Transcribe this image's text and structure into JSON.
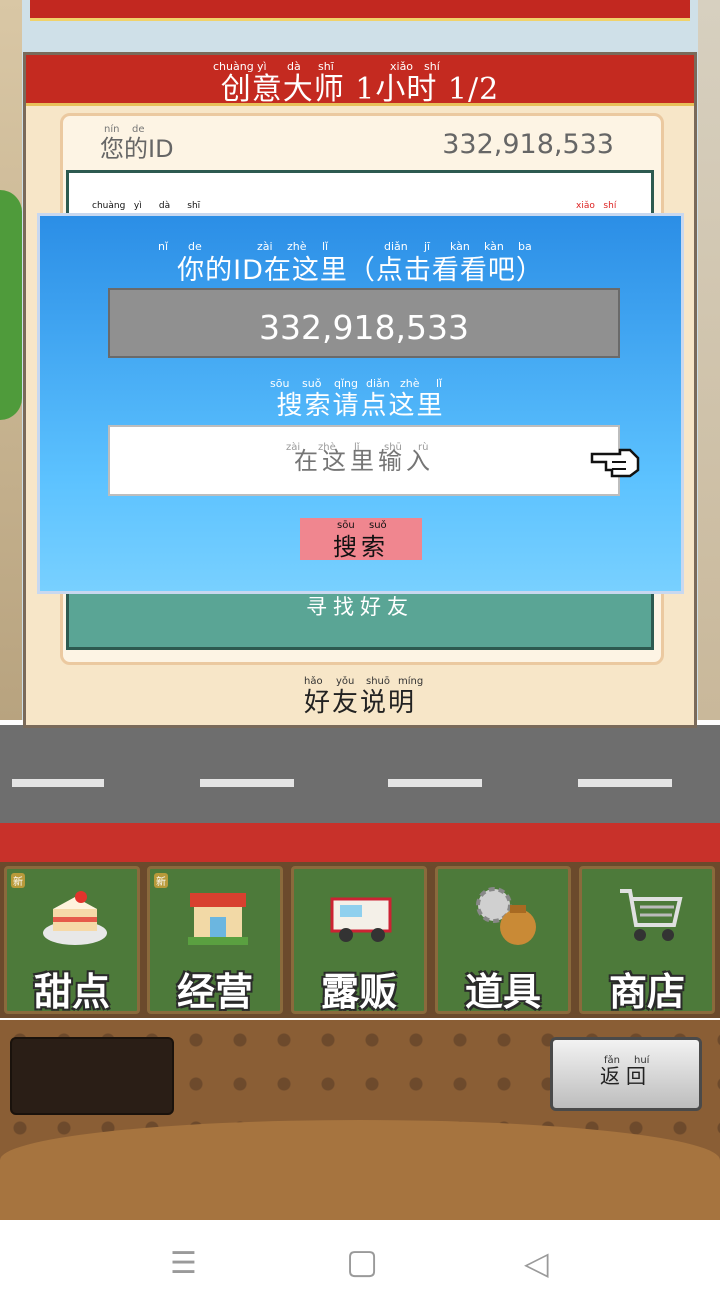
{
  "dialog": {
    "title": "创意大师 1小时 1/2",
    "title_pinyin": [
      "chuàng",
      "yì",
      "dà",
      "shī",
      "xiǎo",
      "shí"
    ],
    "id_label": "您的ID",
    "id_label_pinyin": [
      "nín",
      "de"
    ],
    "id_value": "332,918,533",
    "strip_left_pinyin": "chuàng   yì      dà      shī",
    "strip_right_pinyin": "xiǎo   shí",
    "find_friend": "寻找好友",
    "friend_help": "好友说明",
    "friend_help_pinyin": [
      "hǎo",
      "yǒu",
      "shuō",
      "míng"
    ]
  },
  "modal": {
    "title": "你的ID在这里（点击看看吧）",
    "title_pinyin": [
      "nǐ",
      "de",
      "zài",
      "zhè",
      "lǐ",
      "diǎn",
      "jī",
      "kàn",
      "kàn",
      "ba"
    ],
    "id_value": "332,918,533",
    "search_hint": "搜索请点这里",
    "search_hint_pinyin": [
      "sōu",
      "suǒ",
      "qǐng",
      "diǎn",
      "zhè",
      "lǐ"
    ],
    "input_placeholder": "在这里输入",
    "input_placeholder_pinyin": [
      "zài",
      "zhè",
      "lǐ",
      "shū",
      "rù"
    ],
    "search_button": "搜索",
    "search_button_pinyin": [
      "sōu",
      "suǒ"
    ]
  },
  "menu": {
    "items": [
      {
        "label": "甜点",
        "icon": "cake-icon",
        "new_badge": "新"
      },
      {
        "label": "经营",
        "icon": "shop-icon",
        "new_badge": "新"
      },
      {
        "label": "露贩",
        "icon": "food-truck-icon"
      },
      {
        "label": "道具",
        "icon": "gear-and-bag-icon"
      },
      {
        "label": "商店",
        "icon": "shopping-cart-icon"
      }
    ]
  },
  "back_button": {
    "label": "返回",
    "pinyin": [
      "fǎn",
      "huí"
    ]
  },
  "nav": {
    "icons": [
      "menu-icon",
      "home-icon",
      "back-icon"
    ],
    "glyphs": [
      "☰",
      "▢",
      "◁"
    ]
  },
  "colors": {
    "header_red": "#c42a20",
    "modal_blue": "#2b8ee6",
    "teal_panel": "#5aa595",
    "search_pink": "#f0868f",
    "menu_green": "#4d7a3a"
  }
}
